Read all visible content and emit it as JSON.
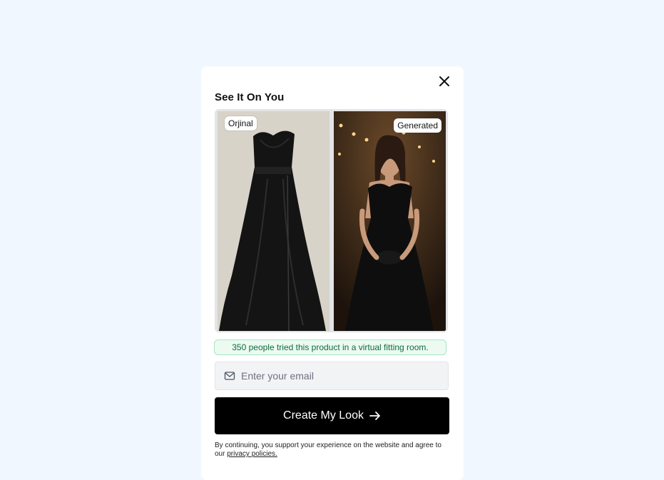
{
  "modal": {
    "title": "See It On You",
    "close_icon": "close-icon"
  },
  "comparison": {
    "original_label": "Orjinal",
    "generated_label": "Generated"
  },
  "stats": {
    "text": "350 people tried this product in a virtual fitting room."
  },
  "email": {
    "icon": "mail-icon",
    "placeholder": "Enter your email",
    "value": ""
  },
  "cta": {
    "label": "Create My Look",
    "icon": "arrow-right-icon"
  },
  "legal": {
    "prefix": "By continuing, you support your experience on the website and agree to our ",
    "link_text": "privacy policies.",
    "suffix": ""
  },
  "colors": {
    "page_bg": "#f0f7fe",
    "cta_bg": "#000000",
    "badge_bg": "#ecfaf2",
    "badge_text": "#106b3a"
  }
}
